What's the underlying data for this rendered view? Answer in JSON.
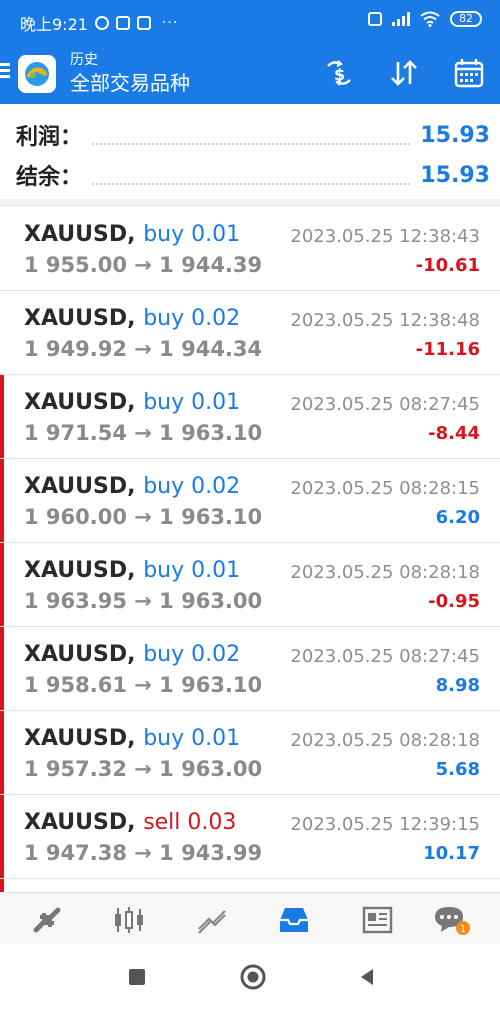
{
  "status_bar": {
    "time": "晚上9:21",
    "battery": "82"
  },
  "appbar": {
    "subtitle": "历史",
    "title": "全部交易品种"
  },
  "summary": {
    "profit_label": "利润：",
    "profit_value": "15.93",
    "balance_label": "结余：",
    "balance_value": "15.93"
  },
  "trades": [
    {
      "symbol": "XAUUSD,",
      "side": "buy 0.01",
      "prices": "1 955.00 → 1 944.39",
      "time": "2023.05.25 12:38:43",
      "pnl": "-10.61"
    },
    {
      "symbol": "XAUUSD,",
      "side": "buy 0.02",
      "prices": "1 949.92 → 1 944.34",
      "time": "2023.05.25 12:38:48",
      "pnl": "-11.16"
    },
    {
      "symbol": "XAUUSD,",
      "side": "buy 0.01",
      "prices": "1 971.54 → 1 963.10",
      "time": "2023.05.25 08:27:45",
      "pnl": "-8.44"
    },
    {
      "symbol": "XAUUSD,",
      "side": "buy 0.02",
      "prices": "1 960.00 → 1 963.10",
      "time": "2023.05.25 08:28:15",
      "pnl": "6.20"
    },
    {
      "symbol": "XAUUSD,",
      "side": "buy 0.01",
      "prices": "1 963.95 → 1 963.00",
      "time": "2023.05.25 08:28:18",
      "pnl": "-0.95"
    },
    {
      "symbol": "XAUUSD,",
      "side": "buy 0.02",
      "prices": "1 958.61 → 1 963.10",
      "time": "2023.05.25 08:27:45",
      "pnl": "8.98"
    },
    {
      "symbol": "XAUUSD,",
      "side": "buy 0.01",
      "prices": "1 957.32 → 1 963.00",
      "time": "2023.05.25 08:28:18",
      "pnl": "5.68"
    },
    {
      "symbol": "XAUUSD,",
      "side": "sell 0.03",
      "prices": "1 947.38 → 1 943.99",
      "time": "2023.05.25 12:39:15",
      "pnl": "10.17"
    }
  ],
  "bottom_nav": {
    "chat_badge": "1"
  },
  "colors": {
    "brand": "#1a7ae6",
    "profit": "#1a7ae6",
    "loss": "#d9141e"
  }
}
